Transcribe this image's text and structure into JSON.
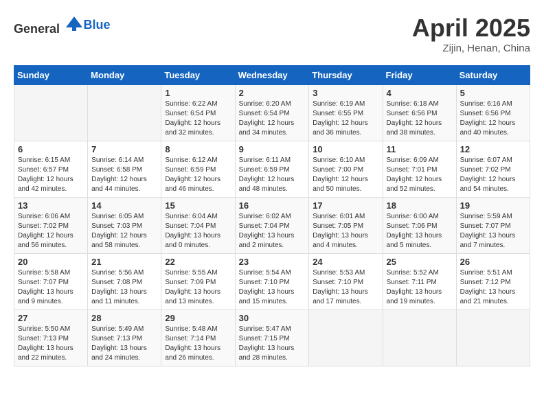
{
  "header": {
    "logo_general": "General",
    "logo_blue": "Blue",
    "title": "April 2025",
    "location": "Zijin, Henan, China"
  },
  "calendar": {
    "days_of_week": [
      "Sunday",
      "Monday",
      "Tuesday",
      "Wednesday",
      "Thursday",
      "Friday",
      "Saturday"
    ],
    "weeks": [
      [
        {
          "day": "",
          "detail": ""
        },
        {
          "day": "",
          "detail": ""
        },
        {
          "day": "1",
          "detail": "Sunrise: 6:22 AM\nSunset: 6:54 PM\nDaylight: 12 hours\nand 32 minutes."
        },
        {
          "day": "2",
          "detail": "Sunrise: 6:20 AM\nSunset: 6:54 PM\nDaylight: 12 hours\nand 34 minutes."
        },
        {
          "day": "3",
          "detail": "Sunrise: 6:19 AM\nSunset: 6:55 PM\nDaylight: 12 hours\nand 36 minutes."
        },
        {
          "day": "4",
          "detail": "Sunrise: 6:18 AM\nSunset: 6:56 PM\nDaylight: 12 hours\nand 38 minutes."
        },
        {
          "day": "5",
          "detail": "Sunrise: 6:16 AM\nSunset: 6:56 PM\nDaylight: 12 hours\nand 40 minutes."
        }
      ],
      [
        {
          "day": "6",
          "detail": "Sunrise: 6:15 AM\nSunset: 6:57 PM\nDaylight: 12 hours\nand 42 minutes."
        },
        {
          "day": "7",
          "detail": "Sunrise: 6:14 AM\nSunset: 6:58 PM\nDaylight: 12 hours\nand 44 minutes."
        },
        {
          "day": "8",
          "detail": "Sunrise: 6:12 AM\nSunset: 6:59 PM\nDaylight: 12 hours\nand 46 minutes."
        },
        {
          "day": "9",
          "detail": "Sunrise: 6:11 AM\nSunset: 6:59 PM\nDaylight: 12 hours\nand 48 minutes."
        },
        {
          "day": "10",
          "detail": "Sunrise: 6:10 AM\nSunset: 7:00 PM\nDaylight: 12 hours\nand 50 minutes."
        },
        {
          "day": "11",
          "detail": "Sunrise: 6:09 AM\nSunset: 7:01 PM\nDaylight: 12 hours\nand 52 minutes."
        },
        {
          "day": "12",
          "detail": "Sunrise: 6:07 AM\nSunset: 7:02 PM\nDaylight: 12 hours\nand 54 minutes."
        }
      ],
      [
        {
          "day": "13",
          "detail": "Sunrise: 6:06 AM\nSunset: 7:02 PM\nDaylight: 12 hours\nand 56 minutes."
        },
        {
          "day": "14",
          "detail": "Sunrise: 6:05 AM\nSunset: 7:03 PM\nDaylight: 12 hours\nand 58 minutes."
        },
        {
          "day": "15",
          "detail": "Sunrise: 6:04 AM\nSunset: 7:04 PM\nDaylight: 13 hours\nand 0 minutes."
        },
        {
          "day": "16",
          "detail": "Sunrise: 6:02 AM\nSunset: 7:04 PM\nDaylight: 13 hours\nand 2 minutes."
        },
        {
          "day": "17",
          "detail": "Sunrise: 6:01 AM\nSunset: 7:05 PM\nDaylight: 13 hours\nand 4 minutes."
        },
        {
          "day": "18",
          "detail": "Sunrise: 6:00 AM\nSunset: 7:06 PM\nDaylight: 13 hours\nand 5 minutes."
        },
        {
          "day": "19",
          "detail": "Sunrise: 5:59 AM\nSunset: 7:07 PM\nDaylight: 13 hours\nand 7 minutes."
        }
      ],
      [
        {
          "day": "20",
          "detail": "Sunrise: 5:58 AM\nSunset: 7:07 PM\nDaylight: 13 hours\nand 9 minutes."
        },
        {
          "day": "21",
          "detail": "Sunrise: 5:56 AM\nSunset: 7:08 PM\nDaylight: 13 hours\nand 11 minutes."
        },
        {
          "day": "22",
          "detail": "Sunrise: 5:55 AM\nSunset: 7:09 PM\nDaylight: 13 hours\nand 13 minutes."
        },
        {
          "day": "23",
          "detail": "Sunrise: 5:54 AM\nSunset: 7:10 PM\nDaylight: 13 hours\nand 15 minutes."
        },
        {
          "day": "24",
          "detail": "Sunrise: 5:53 AM\nSunset: 7:10 PM\nDaylight: 13 hours\nand 17 minutes."
        },
        {
          "day": "25",
          "detail": "Sunrise: 5:52 AM\nSunset: 7:11 PM\nDaylight: 13 hours\nand 19 minutes."
        },
        {
          "day": "26",
          "detail": "Sunrise: 5:51 AM\nSunset: 7:12 PM\nDaylight: 13 hours\nand 21 minutes."
        }
      ],
      [
        {
          "day": "27",
          "detail": "Sunrise: 5:50 AM\nSunset: 7:13 PM\nDaylight: 13 hours\nand 22 minutes."
        },
        {
          "day": "28",
          "detail": "Sunrise: 5:49 AM\nSunset: 7:13 PM\nDaylight: 13 hours\nand 24 minutes."
        },
        {
          "day": "29",
          "detail": "Sunrise: 5:48 AM\nSunset: 7:14 PM\nDaylight: 13 hours\nand 26 minutes."
        },
        {
          "day": "30",
          "detail": "Sunrise: 5:47 AM\nSunset: 7:15 PM\nDaylight: 13 hours\nand 28 minutes."
        },
        {
          "day": "",
          "detail": ""
        },
        {
          "day": "",
          "detail": ""
        },
        {
          "day": "",
          "detail": ""
        }
      ]
    ]
  }
}
